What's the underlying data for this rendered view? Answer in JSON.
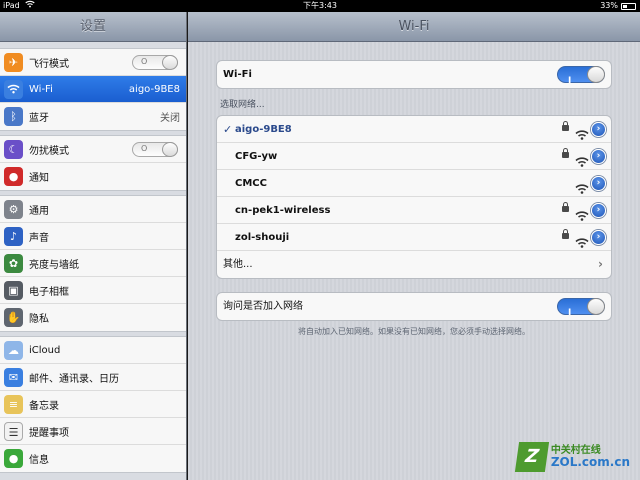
{
  "status_bar": {
    "device": "iPad",
    "time": "下午3:43",
    "battery": "33%"
  },
  "master": {
    "title": "设置",
    "groups": [
      [
        {
          "name": "airplane",
          "label": "飞行模式",
          "icon": "airplane-icon",
          "icon_color": "#f08c22",
          "control": "switch-off"
        },
        {
          "name": "wifi",
          "label": "Wi-Fi",
          "value": "aigo-9BE8",
          "icon": "wifi-icon",
          "icon_color": "#3a7fe0",
          "selected": true
        },
        {
          "name": "bluetooth",
          "label": "蓝牙",
          "value": "关闭",
          "icon": "bluetooth-icon",
          "icon_color": "#4a78c8"
        }
      ],
      [
        {
          "name": "do-not-disturb",
          "label": "勿扰模式",
          "icon": "moon-icon",
          "icon_color": "#6a4fc8",
          "control": "switch-off"
        },
        {
          "name": "notifications",
          "label": "通知",
          "icon": "notification-icon",
          "icon_color": "#d02a2a"
        }
      ],
      [
        {
          "name": "general",
          "label": "通用",
          "icon": "gear-icon",
          "icon_color": "#7e838c"
        },
        {
          "name": "sounds",
          "label": "声音",
          "icon": "speaker-icon",
          "icon_color": "#2e62c4"
        },
        {
          "name": "brightness-wallpaper",
          "label": "亮度与墙纸",
          "icon": "flower-icon",
          "icon_color": "#3c8a40"
        },
        {
          "name": "picture-frame",
          "label": "电子相框",
          "icon": "picture-frame-icon",
          "icon_color": "#555b63"
        },
        {
          "name": "privacy",
          "label": "隐私",
          "icon": "hand-icon",
          "icon_color": "#5f6670"
        }
      ],
      [
        {
          "name": "icloud",
          "label": "iCloud",
          "icon": "cloud-icon",
          "icon_color": "#8fb6e8"
        },
        {
          "name": "mail",
          "label": "邮件、通讯录、日历",
          "icon": "mail-icon",
          "icon_color": "#3a7fe0"
        },
        {
          "name": "notes",
          "label": "备忘录",
          "icon": "notes-icon",
          "icon_color": "#e8c45a"
        },
        {
          "name": "reminders",
          "label": "提醒事项",
          "icon": "reminders-icon",
          "icon_color": "#f2f2f2"
        },
        {
          "name": "messages",
          "label": "信息",
          "icon": "message-icon",
          "icon_color": "#3aa83a"
        }
      ]
    ]
  },
  "detail": {
    "title": "Wi-Fi",
    "wifi_toggle_label": "Wi-Fi",
    "choose_network_label": "选取网络...",
    "networks": [
      {
        "name": "aigo-9BE8",
        "connected": true,
        "locked": true
      },
      {
        "name": "CFG-yw",
        "connected": false,
        "locked": true
      },
      {
        "name": "CMCC",
        "connected": false,
        "locked": false
      },
      {
        "name": "cn-pek1-wireless",
        "connected": false,
        "locked": true
      },
      {
        "name": "zol-shouji",
        "connected": false,
        "locked": true
      }
    ],
    "other_label": "其他...",
    "ask_join_label": "询问是否加入网络",
    "footnote": "将自动加入已知网络。如果没有已知网络，您必须手动选择网络。",
    "switch_on_mark": "I",
    "switch_off_mark": "O"
  },
  "watermark": {
    "logo_letter": "Z",
    "cn": "中关村在线",
    "en": "ZOL.com.cn"
  }
}
